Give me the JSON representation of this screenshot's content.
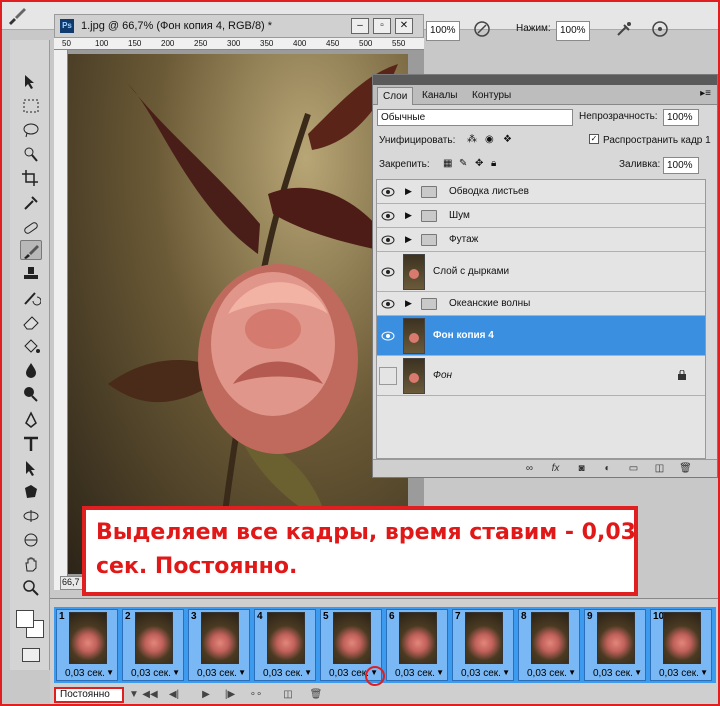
{
  "options_bar": {
    "opacity_value": "100%",
    "pressure_label": "Нажим:",
    "pressure_value": "100%"
  },
  "document": {
    "tab_title": "1.jpg @ 66,7% (Фон копия 4, RGB/8) *",
    "ps_badge": "Ps",
    "zoom": "66,7",
    "ruler_marks": [
      "50",
      "100",
      "150",
      "200",
      "250",
      "300",
      "350",
      "400",
      "450",
      "500",
      "550"
    ]
  },
  "layers_panel": {
    "tabs": [
      "Слои",
      "Каналы",
      "Контуры"
    ],
    "blend_mode": "Обычные",
    "opacity_label": "Непрозрачность:",
    "opacity_value": "100%",
    "unify_label": "Унифицировать:",
    "propagate_label": "Распространить кадр 1",
    "lock_label": "Закрепить:",
    "fill_label": "Заливка:",
    "fill_value": "100%",
    "layers": [
      {
        "name": "Обводка листьев",
        "type": "group"
      },
      {
        "name": "Шум",
        "type": "group"
      },
      {
        "name": "Футаж",
        "type": "group"
      },
      {
        "name": "Слой с дырками",
        "type": "layer"
      },
      {
        "name": "Океанские волны",
        "type": "group"
      },
      {
        "name": "Фон копия 4",
        "type": "layer",
        "selected": true
      },
      {
        "name": "Фон",
        "type": "layer",
        "locked": true
      }
    ],
    "footer_icons": [
      "link-icon",
      "fx-icon",
      "mask-icon",
      "adjustment-icon",
      "group-icon",
      "new-layer-icon",
      "trash-icon"
    ]
  },
  "annotation": {
    "text": "Выделяем все кадры, время ставим - 0,03 сек. Постоянно."
  },
  "animation": {
    "frames": [
      {
        "num": "1",
        "delay": "0,03 сек."
      },
      {
        "num": "2",
        "delay": "0,03 сек."
      },
      {
        "num": "3",
        "delay": "0,03 сек."
      },
      {
        "num": "4",
        "delay": "0,03 сек."
      },
      {
        "num": "5",
        "delay": "0,03 сек."
      },
      {
        "num": "6",
        "delay": "0,03 сек."
      },
      {
        "num": "7",
        "delay": "0,03 сек."
      },
      {
        "num": "8",
        "delay": "0,03 сек."
      },
      {
        "num": "9",
        "delay": "0,03 сек."
      },
      {
        "num": "10",
        "delay": "0,03 сек."
      }
    ],
    "loop_option": "Постоянно"
  },
  "colors": {
    "selection_blue": "#3b8fe0",
    "frames_blue": "#3d9bef",
    "annotation_red": "#e01818"
  }
}
